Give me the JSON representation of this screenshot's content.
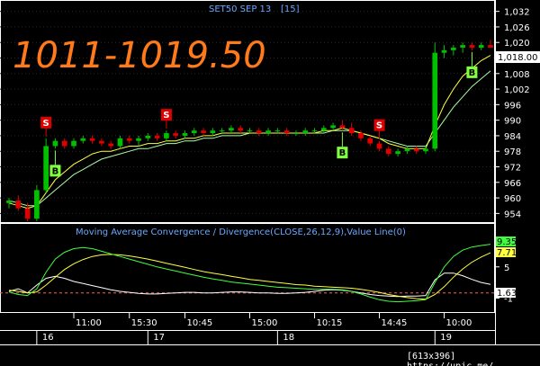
{
  "chart_data": {
    "type": "candlestick",
    "title": "SET50 SEP 13",
    "interval_label": "[15]",
    "range_annotation": "1011-1019.50",
    "colors": {
      "up": "#00c000",
      "down": "#e00000",
      "ma_fast": "#ffff40",
      "ma_slow": "#a8ffa8",
      "sell_signal": "#e00000",
      "buy_signal": "#80ff40",
      "last_price_box": "#ffffff",
      "macd_line": "#40ff40",
      "signal_line": "#ffff40",
      "value_line": "#ffffff",
      "zero_line": "#ff6060",
      "title": "#6aa8ff",
      "big_text": "#ff7a1a"
    },
    "price_axis": {
      "ticks": [
        "1,032",
        "1,026",
        "1,020",
        "1,014",
        "1,008",
        "1,002",
        "996",
        "990",
        "984",
        "978",
        "972",
        "966",
        "960",
        "954"
      ],
      "ylim": [
        951,
        1035
      ],
      "last_price_label": "1,018.00",
      "last_price": 1018.0
    },
    "ohlc": [
      [
        958,
        960,
        956,
        959
      ],
      [
        959,
        961,
        955,
        956
      ],
      [
        956,
        958,
        951,
        952
      ],
      [
        952,
        965,
        951,
        963
      ],
      [
        963,
        983,
        962,
        980
      ],
      [
        980,
        983,
        979,
        982
      ],
      [
        982,
        983,
        979,
        980
      ],
      [
        980,
        983,
        979,
        982
      ],
      [
        982,
        984,
        981,
        983
      ],
      [
        983,
        984,
        981,
        982
      ],
      [
        982,
        983,
        980,
        981
      ],
      [
        981,
        982,
        979,
        980
      ],
      [
        980,
        984,
        979,
        983
      ],
      [
        983,
        984,
        981,
        982
      ],
      [
        982,
        984,
        980,
        983
      ],
      [
        983,
        985,
        982,
        984
      ],
      [
        984,
        985,
        982,
        983
      ],
      [
        983,
        986,
        982,
        985
      ],
      [
        985,
        986,
        983,
        984
      ],
      [
        984,
        986,
        983,
        985
      ],
      [
        985,
        987,
        984,
        986
      ],
      [
        986,
        987,
        984,
        985
      ],
      [
        985,
        987,
        984,
        986
      ],
      [
        986,
        987,
        985,
        986
      ],
      [
        986,
        988,
        985,
        987
      ],
      [
        987,
        988,
        985,
        986
      ],
      [
        986,
        987,
        985,
        986
      ],
      [
        986,
        987,
        984,
        985
      ],
      [
        985,
        987,
        984,
        986
      ],
      [
        986,
        987,
        985,
        986
      ],
      [
        986,
        987,
        984,
        985
      ],
      [
        985,
        986,
        984,
        985
      ],
      [
        985,
        987,
        984,
        986
      ],
      [
        986,
        987,
        985,
        986
      ],
      [
        986,
        988,
        985,
        987
      ],
      [
        987,
        989,
        986,
        988
      ],
      [
        988,
        990,
        986,
        987
      ],
      [
        987,
        989,
        984,
        985
      ],
      [
        985,
        986,
        982,
        983
      ],
      [
        983,
        984,
        980,
        981
      ],
      [
        981,
        982,
        978,
        979
      ],
      [
        979,
        980,
        976,
        977
      ],
      [
        977,
        979,
        976,
        978
      ],
      [
        978,
        980,
        977,
        979
      ],
      [
        979,
        980,
        977,
        978
      ],
      [
        978,
        980,
        977,
        979
      ],
      [
        979,
        1020,
        978,
        1016
      ],
      [
        1016,
        1019,
        1014,
        1017
      ],
      [
        1017,
        1019,
        1015,
        1018
      ],
      [
        1018,
        1020,
        1016,
        1019
      ],
      [
        1019,
        1020,
        1017,
        1018
      ],
      [
        1018,
        1020,
        1017,
        1019
      ],
      [
        1019,
        1021,
        1018,
        1018
      ]
    ],
    "ma_fast": [
      958,
      957,
      956,
      957,
      962,
      967,
      970,
      973,
      975,
      977,
      978,
      978,
      979,
      980,
      980,
      981,
      981,
      982,
      982,
      983,
      983,
      984,
      984,
      985,
      985,
      985,
      985,
      985,
      985,
      985,
      985,
      985,
      985,
      985,
      986,
      986,
      987,
      986,
      985,
      984,
      983,
      981,
      980,
      979,
      979,
      979,
      988,
      996,
      1002,
      1007,
      1010,
      1013,
      1015
    ],
    "ma_slow": [
      959,
      958,
      957,
      957,
      960,
      963,
      966,
      969,
      971,
      973,
      975,
      976,
      977,
      978,
      979,
      979,
      980,
      981,
      981,
      982,
      982,
      983,
      983,
      984,
      984,
      984,
      985,
      985,
      985,
      985,
      985,
      985,
      985,
      985,
      985,
      986,
      986,
      986,
      985,
      984,
      983,
      982,
      981,
      980,
      980,
      980,
      985,
      990,
      995,
      999,
      1003,
      1006,
      1009
    ],
    "signals": [
      {
        "label": "S",
        "kind": "sell",
        "bar": 4
      },
      {
        "label": "B",
        "kind": "buy",
        "bar": 5
      },
      {
        "label": "S",
        "kind": "sell",
        "bar": 17
      },
      {
        "label": "B",
        "kind": "buy",
        "bar": 36
      },
      {
        "label": "S",
        "kind": "sell",
        "bar": 40
      },
      {
        "label": "B",
        "kind": "buy",
        "bar": 50
      }
    ],
    "indicator": {
      "title": "Moving Average Convergence / Divergence(CLOSE,26,12,9),Value Line(0)",
      "ticks": [
        "5",
        "-1"
      ],
      "ylim": [
        -3.5,
        11
      ],
      "labels": {
        "macd": "9.35",
        "signal": "7.71",
        "value": "1.63"
      },
      "macd": [
        0.2,
        -0.3,
        -0.5,
        0.8,
        4,
        6.5,
        7.8,
        8.5,
        8.7,
        8.5,
        8.0,
        7.5,
        7.0,
        6.5,
        6.0,
        5.5,
        5.0,
        4.6,
        4.2,
        3.8,
        3.4,
        3.0,
        2.7,
        2.4,
        2.1,
        1.9,
        1.7,
        1.5,
        1.3,
        1.1,
        1.0,
        0.9,
        0.8,
        0.7,
        0.7,
        0.7,
        0.6,
        0.3,
        -0.2,
        -0.8,
        -1.3,
        -1.6,
        -1.7,
        -1.6,
        -1.5,
        -1.3,
        2,
        5,
        7,
        8.2,
        8.8,
        9.1,
        9.35
      ],
      "signal_line": [
        0.5,
        0.3,
        0.0,
        0.2,
        1.5,
        3.0,
        4.5,
        5.6,
        6.4,
        7.0,
        7.3,
        7.4,
        7.3,
        7.1,
        6.8,
        6.5,
        6.1,
        5.7,
        5.3,
        4.9,
        4.5,
        4.1,
        3.8,
        3.5,
        3.2,
        2.9,
        2.6,
        2.4,
        2.2,
        2.0,
        1.8,
        1.6,
        1.5,
        1.3,
        1.2,
        1.1,
        1.0,
        0.9,
        0.7,
        0.4,
        0.1,
        -0.3,
        -0.6,
        -0.9,
        -1.1,
        -1.2,
        -0.3,
        1.2,
        3.0,
        4.6,
        5.9,
        6.9,
        7.71
      ],
      "value_line": [
        0.3,
        0.8,
        0.0,
        1.5,
        2.8,
        3.2,
        2.8,
        2.2,
        1.8,
        1.4,
        1.0,
        0.6,
        0.3,
        0.1,
        -0.1,
        -0.2,
        -0.2,
        -0.1,
        0,
        0.1,
        0.1,
        0,
        0,
        0.1,
        0.2,
        0.2,
        0.1,
        0,
        0,
        -0.1,
        -0.1,
        0,
        0.1,
        0.3,
        0.5,
        0.6,
        0.5,
        0.3,
        0.0,
        -0.3,
        -0.5,
        -0.6,
        -0.7,
        -0.6,
        -0.6,
        -0.5,
        2.5,
        3.8,
        3.8,
        3.3,
        2.6,
        2.0,
        1.63
      ],
      "zero_line": 0
    },
    "time_axis": {
      "time_labels": [
        {
          "text": "11:00",
          "bar": 7
        },
        {
          "text": "15:30",
          "bar": 13
        },
        {
          "text": "10:45",
          "bar": 19
        },
        {
          "text": "15:00",
          "bar": 26
        },
        {
          "text": "10:15",
          "bar": 33
        },
        {
          "text": "14:45",
          "bar": 40
        },
        {
          "text": "10:00",
          "bar": 47
        }
      ],
      "date_labels": [
        {
          "text": "16",
          "bar": 3
        },
        {
          "text": "17",
          "bar": 15
        },
        {
          "text": "18",
          "bar": 29
        },
        {
          "text": "19",
          "bar": 46
        }
      ]
    }
  },
  "footer_text": "[613x396] https://upic.me/"
}
